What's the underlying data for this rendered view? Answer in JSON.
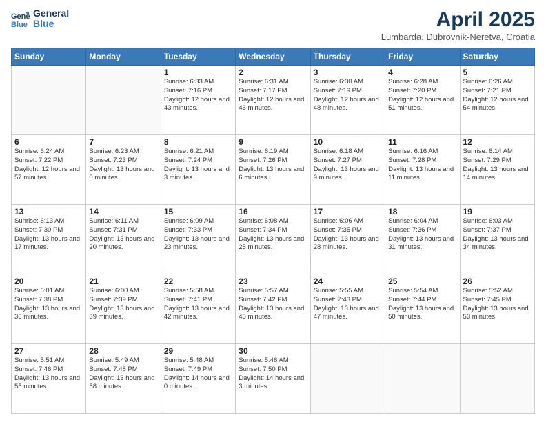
{
  "header": {
    "logo_line1": "General",
    "logo_line2": "Blue",
    "month": "April 2025",
    "location": "Lumbarda, Dubrovnik-Neretva, Croatia"
  },
  "weekdays": [
    "Sunday",
    "Monday",
    "Tuesday",
    "Wednesday",
    "Thursday",
    "Friday",
    "Saturday"
  ],
  "weeks": [
    [
      {
        "day": "",
        "info": ""
      },
      {
        "day": "",
        "info": ""
      },
      {
        "day": "1",
        "info": "Sunrise: 6:33 AM\nSunset: 7:16 PM\nDaylight: 12 hours and 43 minutes."
      },
      {
        "day": "2",
        "info": "Sunrise: 6:31 AM\nSunset: 7:17 PM\nDaylight: 12 hours and 46 minutes."
      },
      {
        "day": "3",
        "info": "Sunrise: 6:30 AM\nSunset: 7:19 PM\nDaylight: 12 hours and 48 minutes."
      },
      {
        "day": "4",
        "info": "Sunrise: 6:28 AM\nSunset: 7:20 PM\nDaylight: 12 hours and 51 minutes."
      },
      {
        "day": "5",
        "info": "Sunrise: 6:26 AM\nSunset: 7:21 PM\nDaylight: 12 hours and 54 minutes."
      }
    ],
    [
      {
        "day": "6",
        "info": "Sunrise: 6:24 AM\nSunset: 7:22 PM\nDaylight: 12 hours and 57 minutes."
      },
      {
        "day": "7",
        "info": "Sunrise: 6:23 AM\nSunset: 7:23 PM\nDaylight: 13 hours and 0 minutes."
      },
      {
        "day": "8",
        "info": "Sunrise: 6:21 AM\nSunset: 7:24 PM\nDaylight: 13 hours and 3 minutes."
      },
      {
        "day": "9",
        "info": "Sunrise: 6:19 AM\nSunset: 7:26 PM\nDaylight: 13 hours and 6 minutes."
      },
      {
        "day": "10",
        "info": "Sunrise: 6:18 AM\nSunset: 7:27 PM\nDaylight: 13 hours and 9 minutes."
      },
      {
        "day": "11",
        "info": "Sunrise: 6:16 AM\nSunset: 7:28 PM\nDaylight: 13 hours and 11 minutes."
      },
      {
        "day": "12",
        "info": "Sunrise: 6:14 AM\nSunset: 7:29 PM\nDaylight: 13 hours and 14 minutes."
      }
    ],
    [
      {
        "day": "13",
        "info": "Sunrise: 6:13 AM\nSunset: 7:30 PM\nDaylight: 13 hours and 17 minutes."
      },
      {
        "day": "14",
        "info": "Sunrise: 6:11 AM\nSunset: 7:31 PM\nDaylight: 13 hours and 20 minutes."
      },
      {
        "day": "15",
        "info": "Sunrise: 6:09 AM\nSunset: 7:33 PM\nDaylight: 13 hours and 23 minutes."
      },
      {
        "day": "16",
        "info": "Sunrise: 6:08 AM\nSunset: 7:34 PM\nDaylight: 13 hours and 25 minutes."
      },
      {
        "day": "17",
        "info": "Sunrise: 6:06 AM\nSunset: 7:35 PM\nDaylight: 13 hours and 28 minutes."
      },
      {
        "day": "18",
        "info": "Sunrise: 6:04 AM\nSunset: 7:36 PM\nDaylight: 13 hours and 31 minutes."
      },
      {
        "day": "19",
        "info": "Sunrise: 6:03 AM\nSunset: 7:37 PM\nDaylight: 13 hours and 34 minutes."
      }
    ],
    [
      {
        "day": "20",
        "info": "Sunrise: 6:01 AM\nSunset: 7:38 PM\nDaylight: 13 hours and 36 minutes."
      },
      {
        "day": "21",
        "info": "Sunrise: 6:00 AM\nSunset: 7:39 PM\nDaylight: 13 hours and 39 minutes."
      },
      {
        "day": "22",
        "info": "Sunrise: 5:58 AM\nSunset: 7:41 PM\nDaylight: 13 hours and 42 minutes."
      },
      {
        "day": "23",
        "info": "Sunrise: 5:57 AM\nSunset: 7:42 PM\nDaylight: 13 hours and 45 minutes."
      },
      {
        "day": "24",
        "info": "Sunrise: 5:55 AM\nSunset: 7:43 PM\nDaylight: 13 hours and 47 minutes."
      },
      {
        "day": "25",
        "info": "Sunrise: 5:54 AM\nSunset: 7:44 PM\nDaylight: 13 hours and 50 minutes."
      },
      {
        "day": "26",
        "info": "Sunrise: 5:52 AM\nSunset: 7:45 PM\nDaylight: 13 hours and 53 minutes."
      }
    ],
    [
      {
        "day": "27",
        "info": "Sunrise: 5:51 AM\nSunset: 7:46 PM\nDaylight: 13 hours and 55 minutes."
      },
      {
        "day": "28",
        "info": "Sunrise: 5:49 AM\nSunset: 7:48 PM\nDaylight: 13 hours and 58 minutes."
      },
      {
        "day": "29",
        "info": "Sunrise: 5:48 AM\nSunset: 7:49 PM\nDaylight: 14 hours and 0 minutes."
      },
      {
        "day": "30",
        "info": "Sunrise: 5:46 AM\nSunset: 7:50 PM\nDaylight: 14 hours and 3 minutes."
      },
      {
        "day": "",
        "info": ""
      },
      {
        "day": "",
        "info": ""
      },
      {
        "day": "",
        "info": ""
      }
    ]
  ]
}
